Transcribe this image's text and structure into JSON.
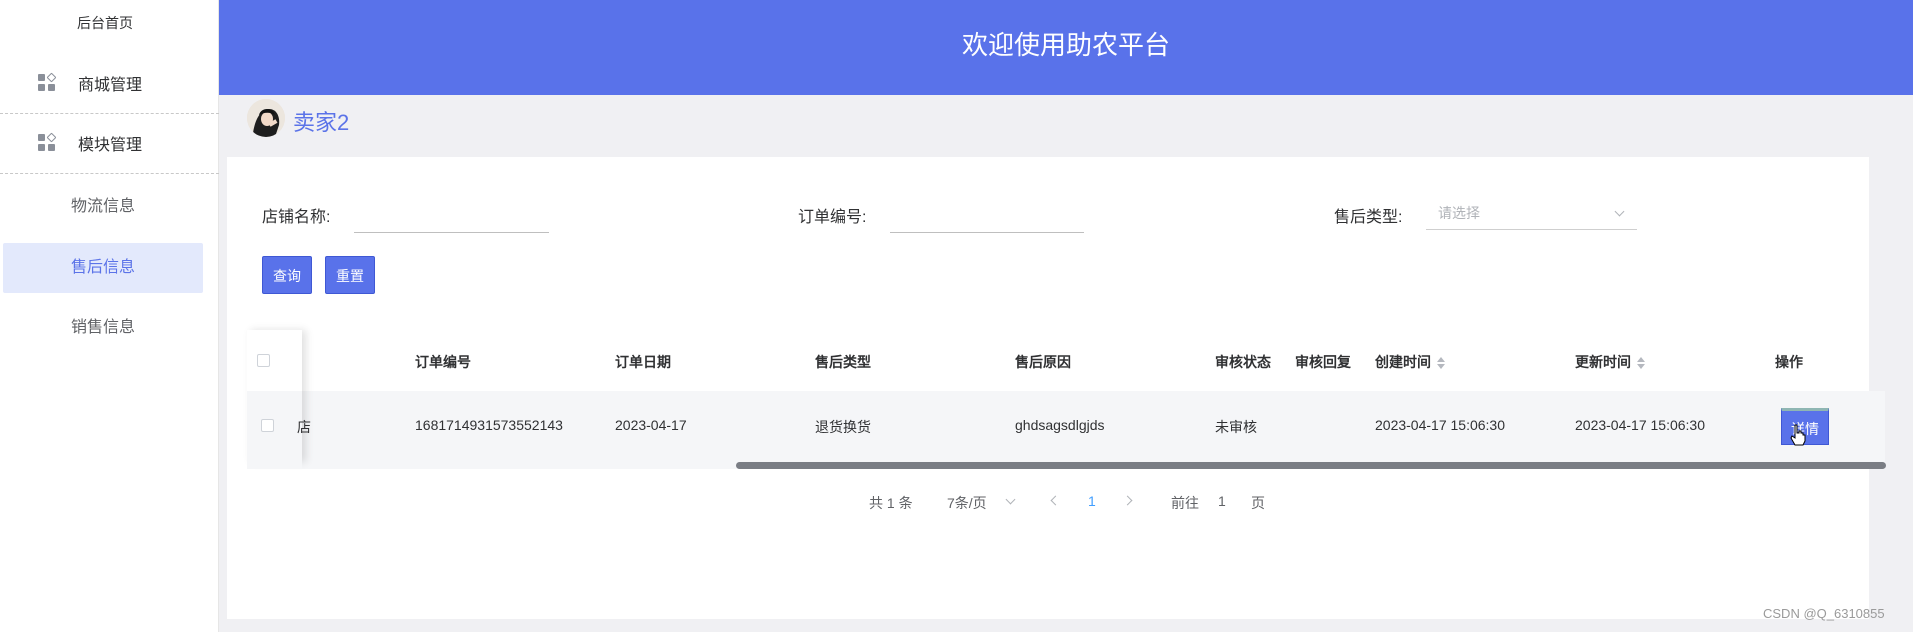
{
  "sidebar": {
    "home": "后台首页",
    "menus": [
      {
        "label": "商城管理"
      },
      {
        "label": "模块管理"
      }
    ],
    "items": [
      {
        "label": "物流信息"
      },
      {
        "label": "售后信息",
        "active": true
      },
      {
        "label": "销售信息"
      }
    ]
  },
  "header": {
    "title": "欢迎使用助农平台"
  },
  "user": {
    "name": "卖家2"
  },
  "filters": {
    "store_label": "店铺名称:",
    "order_label": "订单编号:",
    "type_label": "售后类型:",
    "type_placeholder": "请选择",
    "query_button": "查询",
    "reset_button": "重置"
  },
  "table": {
    "columns": [
      "订单编号",
      "订单日期",
      "售后类型",
      "售后原因",
      "审核状态",
      "审核回复",
      "创建时间",
      "更新时间",
      "操作"
    ],
    "rows": [
      {
        "partial_cell": "店",
        "order_no": "1681714931573552143",
        "order_date": "2023-04-17",
        "type": "退货换货",
        "reason": "ghdsagsdlgjds",
        "status": "未审核",
        "reply": "",
        "created": "2023-04-17 15:06:30",
        "updated": "2023-04-17 15:06:30",
        "action": "详情"
      }
    ]
  },
  "pagination": {
    "total": "共 1 条",
    "page_size": "7条/页",
    "current": "1",
    "goto_prefix": "前往",
    "goto_value": "1",
    "goto_suffix": "页"
  },
  "watermark": "CSDN @Q_6310855",
  "colors": {
    "primary": "#5972ea",
    "active_bg": "#e3e9fc"
  }
}
